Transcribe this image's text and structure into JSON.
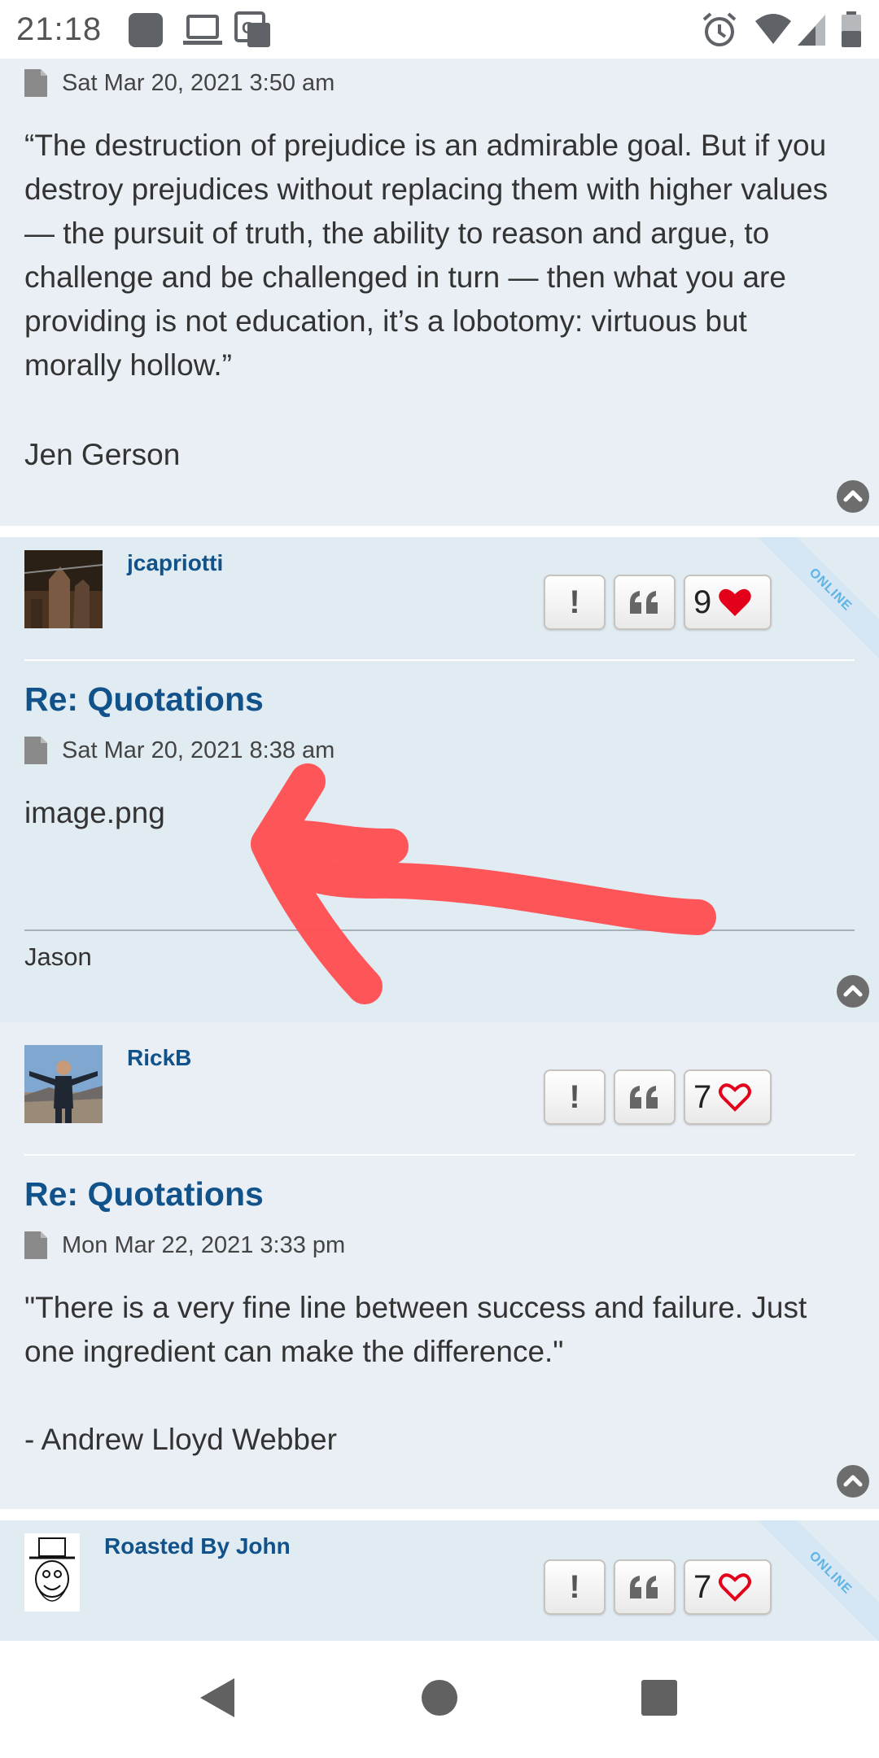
{
  "status_bar": {
    "time": "21:18"
  },
  "posts": [
    {
      "date": "Sat Mar 20, 2021 3:50 am",
      "body": [
        "“The destruction of prejudice is an admirable goal. But if you destroy prejudices without replacing them with higher values — the pursuit of truth, the ability to reason and argue, to challenge and be challenged in turn — then what you are providing is not education, it’s a lobotomy: virtuous but morally hollow.”",
        "Jen Gerson"
      ]
    },
    {
      "username": "jcapriotti",
      "likes": "9",
      "liked": true,
      "online_badge": "ONLINE",
      "title": "Re: Quotations",
      "date": "Sat Mar 20, 2021 8:38 am",
      "body": [
        "image.png"
      ],
      "signature": "Jason"
    },
    {
      "username": "RickB",
      "likes": "7",
      "liked": false,
      "title": "Re: Quotations",
      "date": "Mon Mar 22, 2021 3:33 pm",
      "body": [
        "\"There is a very fine line between success and failure. Just one ingredient can make the difference.\"",
        "- Andrew Lloyd Webber"
      ]
    },
    {
      "username": "Roasted By John",
      "likes": "7",
      "liked": false,
      "online_badge": "ONLINE"
    }
  ],
  "colors": {
    "username": "#105289",
    "post_bg_light": "#e9eff5",
    "post_bg_dark": "#e1ebf2",
    "heart": "#e3001b",
    "annotation_arrow": "#ff5054"
  }
}
